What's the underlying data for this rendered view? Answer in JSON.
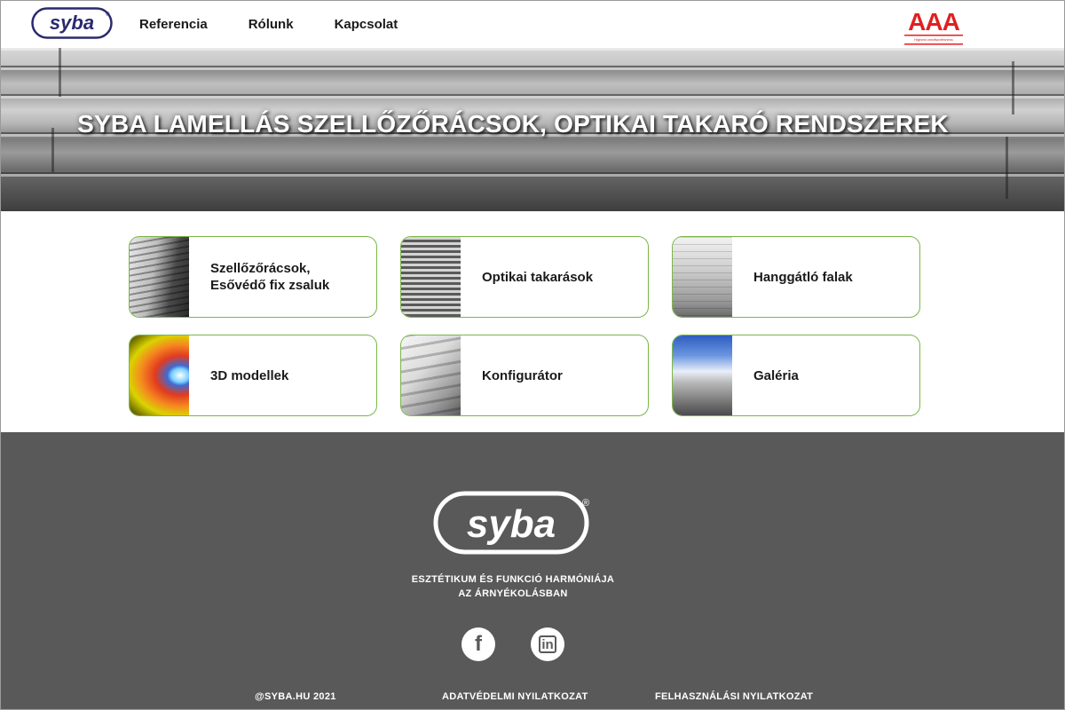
{
  "nav": {
    "logo_text": "syba",
    "links": [
      {
        "label": "Referencia"
      },
      {
        "label": "Rólunk"
      },
      {
        "label": "Kapcsolat"
      }
    ],
    "aaa_logo": {
      "text": "AAA",
      "subtext": "Highest creditworthiness",
      "color": "#e0201f"
    }
  },
  "hero": {
    "title": "SYBA LAMELLÁS SZELLŐZŐRÁCSOK, OPTIKAI TAKARÓ RENDSZEREK"
  },
  "cards": [
    {
      "label": "Szellőzőrácsok,",
      "label2": "Esővédő fix zsaluk"
    },
    {
      "label": "Optikai takarások"
    },
    {
      "label": "Hanggátló falak"
    },
    {
      "label": "3D modellek"
    },
    {
      "label": "Konfigurátor"
    },
    {
      "label": "Galéria"
    }
  ],
  "footer": {
    "logo_text": "syba",
    "tagline_line1": "ESZTÉTIKUM ÉS FUNKCIÓ HARMÓNIÁJA",
    "tagline_line2": "AZ ÁRNYÉKOLÁSBAN",
    "social": [
      {
        "icon": "facebook-icon",
        "glyph": "f"
      },
      {
        "icon": "linkedin-icon",
        "glyph": "in"
      }
    ],
    "links": [
      {
        "label": "@SYBA.HU 2021"
      },
      {
        "label": "ADATVÉDELMI NYILATKOZAT"
      },
      {
        "label": "FELHASZNÁLÁSI NYILATKOZAT"
      }
    ]
  },
  "colors": {
    "accent_green": "#7ab648",
    "logo_navy": "#2b2a6e",
    "footer_bg": "#595959",
    "aaa_red": "#e0201f"
  }
}
